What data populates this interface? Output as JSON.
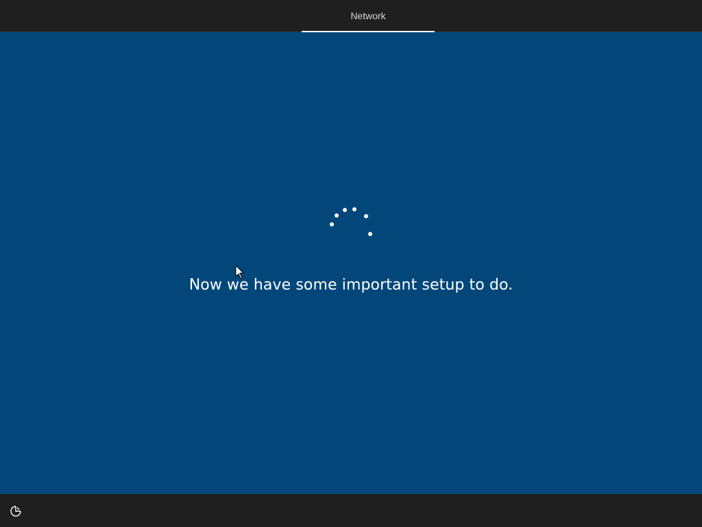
{
  "header": {
    "tab_label": "Network"
  },
  "main": {
    "message": "Now we have some important setup to do.",
    "background_color": "#03477a"
  },
  "spinner": {
    "icon": "loading-dots-icon"
  },
  "footer": {
    "ease_of_access_icon": "ease-of-access-icon"
  }
}
